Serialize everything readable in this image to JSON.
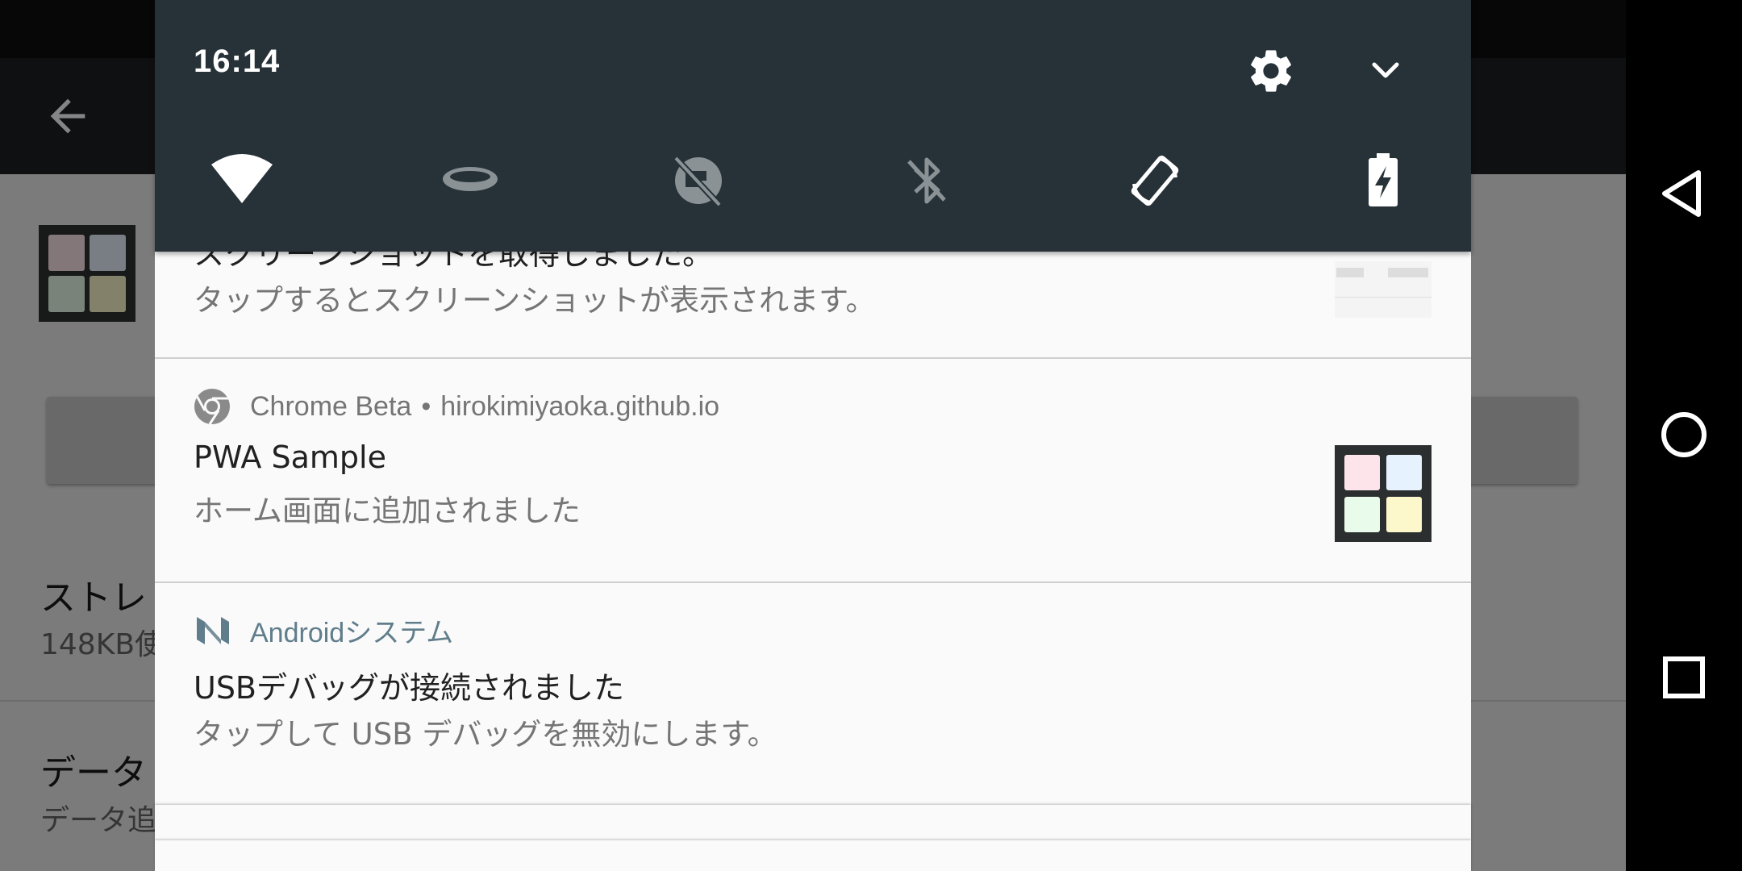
{
  "status_bar": {
    "time": "16:14"
  },
  "quick_settings": {
    "tiles": [
      "wifi",
      "hotspot",
      "data-saver",
      "bluetooth-off",
      "auto-rotate",
      "battery-charging"
    ]
  },
  "notifications": [
    {
      "title": "スクリーンショットを取得しました。",
      "text": "タップするとスクリーンショットが表示されます。"
    },
    {
      "app": "Chrome Beta",
      "separator": "•",
      "source": "hirokimiyaoka.github.io",
      "title": "PWA Sample",
      "text": "ホーム画面に追加されました"
    },
    {
      "app": "Androidシステム",
      "title": "USBデバッグが接続されました",
      "text": "タップして USB デバッグを無効にします。",
      "accent": "#607d8b"
    }
  ],
  "background_app": {
    "item1_title": "ストレ",
    "item1_sub": "148KB使",
    "item2_title": "データ",
    "item2_sub": "データ追"
  },
  "colors": {
    "shade_header": "#263238",
    "tile_pink": "#fde4ea",
    "tile_blue": "#e6f2fe",
    "tile_green": "#e9fbea",
    "tile_yellow": "#fdf7cc"
  }
}
